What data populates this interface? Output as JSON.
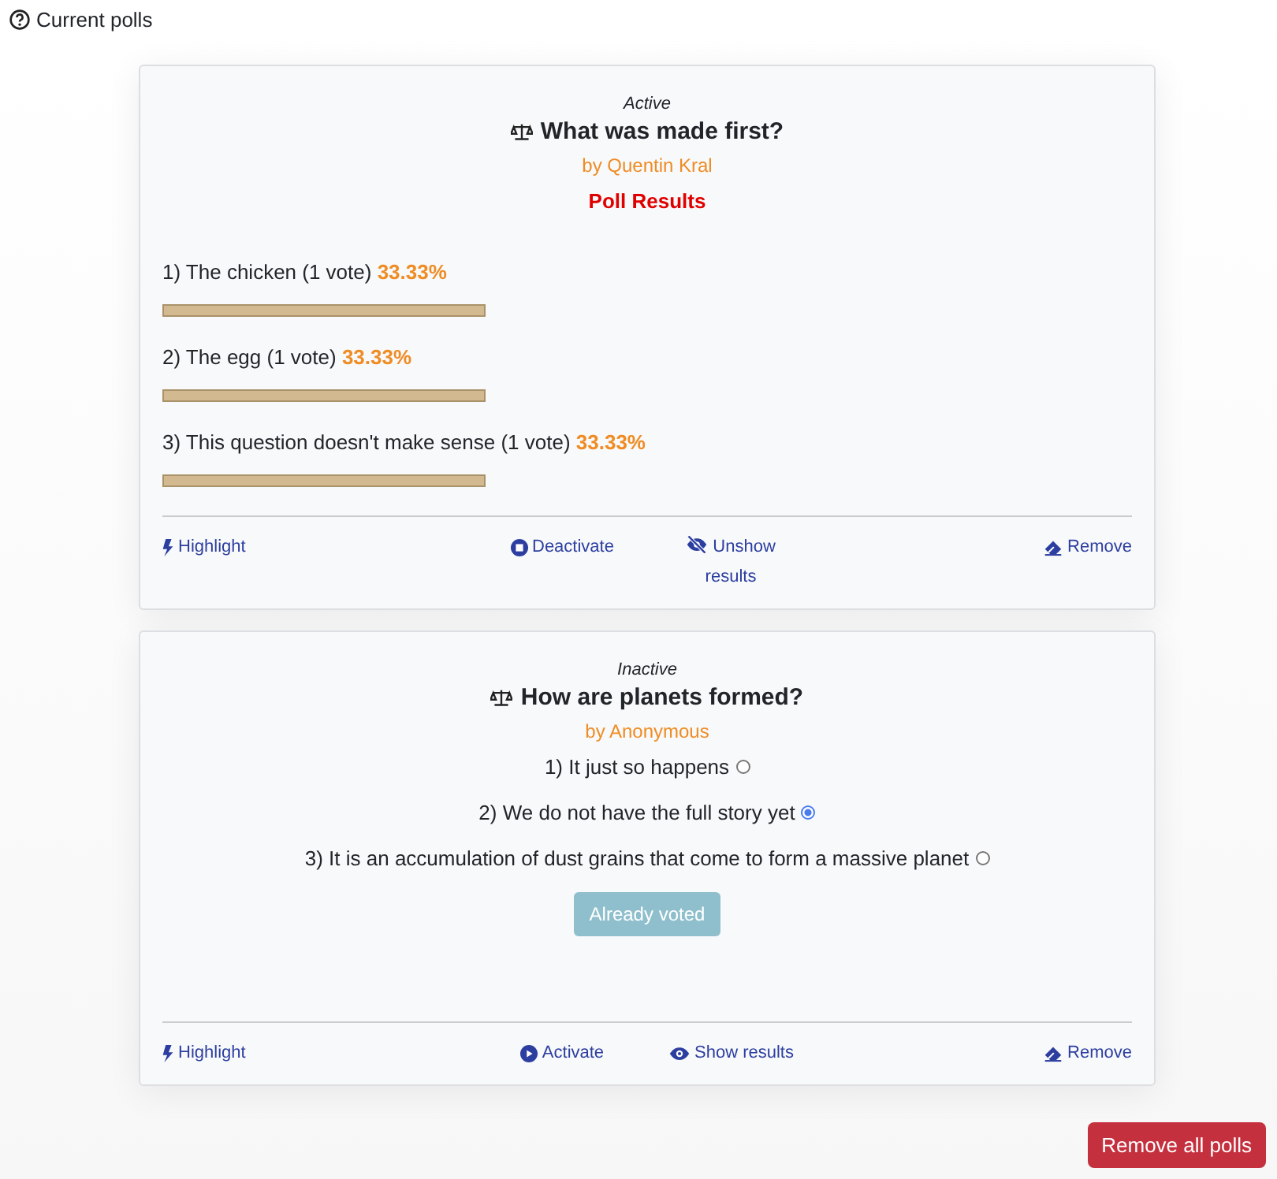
{
  "header": {
    "title": "Current polls"
  },
  "polls": [
    {
      "kind": "results",
      "status": "Active",
      "question": "What was made first?",
      "author": "by Quentin Kral",
      "results_title": "Poll Results",
      "options": [
        {
          "label": "1) The chicken (1 vote)",
          "percent": "33.33%"
        },
        {
          "label": "2) The egg (1 vote)",
          "percent": "33.33%"
        },
        {
          "label": "3) This question doesn't make sense (1 vote)",
          "percent": "33.33%"
        }
      ],
      "actions": [
        {
          "kind": "highlight",
          "label": "Highlight"
        },
        {
          "kind": "deactivate",
          "label": "Deactivate"
        },
        {
          "kind": "unshow",
          "label": "Unshow results"
        },
        {
          "kind": "remove",
          "label": "Remove"
        }
      ]
    },
    {
      "kind": "vote",
      "status": "Inactive",
      "question": "How are planets formed?",
      "author": "by Anonymous",
      "options": [
        {
          "label": "1) It just so happens",
          "selected": false
        },
        {
          "label": "2) We do not have the full story yet",
          "selected": true
        },
        {
          "label": "3) It is an accumulation of dust grains that come to form a massive planet",
          "selected": false
        }
      ],
      "vote_button": {
        "label": "Already voted",
        "disabled": true
      },
      "actions": [
        {
          "kind": "highlight",
          "label": "Highlight"
        },
        {
          "kind": "activate",
          "label": "Activate"
        },
        {
          "kind": "show",
          "label": "Show results"
        },
        {
          "kind": "remove",
          "label": "Remove"
        }
      ]
    }
  ],
  "footer_button": {
    "label": "Remove all polls"
  }
}
